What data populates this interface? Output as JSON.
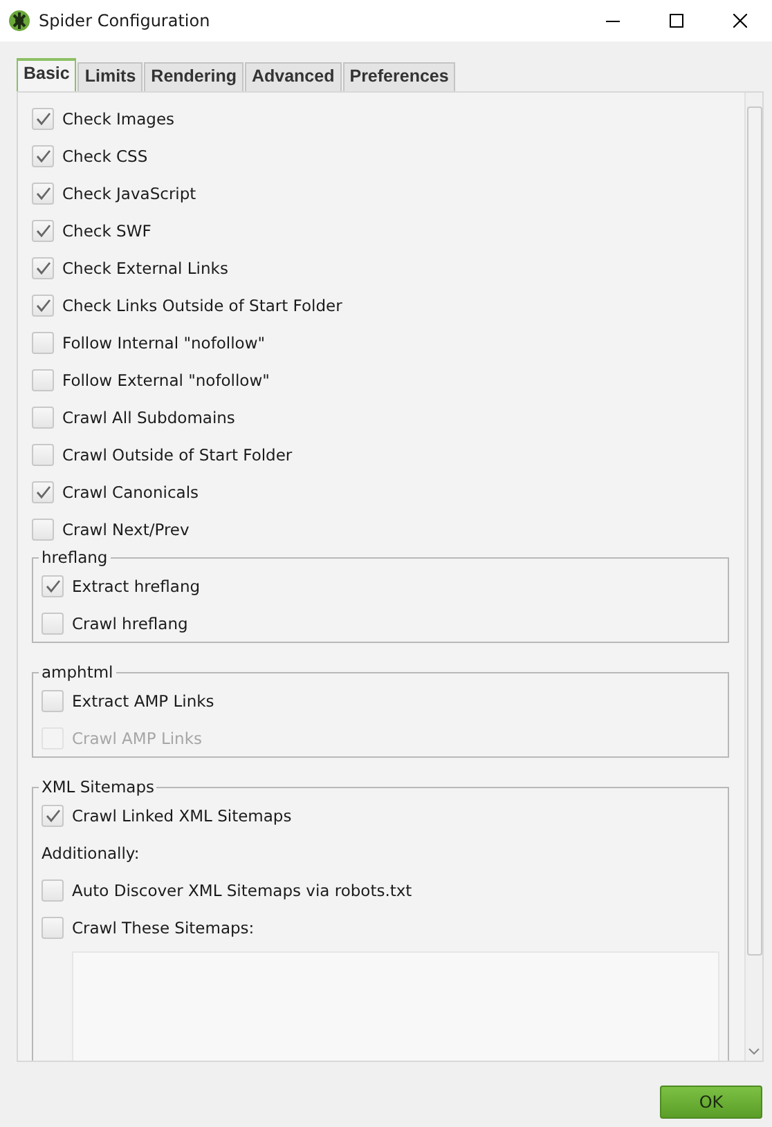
{
  "window": {
    "title": "Spider Configuration"
  },
  "tabs": [
    {
      "label": "Basic",
      "selected": true
    },
    {
      "label": "Limits",
      "selected": false
    },
    {
      "label": "Rendering",
      "selected": false
    },
    {
      "label": "Advanced",
      "selected": false
    },
    {
      "label": "Preferences",
      "selected": false
    }
  ],
  "options": [
    {
      "label": "Check Images",
      "checked": true
    },
    {
      "label": "Check CSS",
      "checked": true
    },
    {
      "label": "Check JavaScript",
      "checked": true
    },
    {
      "label": "Check SWF",
      "checked": true
    },
    {
      "label": "Check External Links",
      "checked": true
    },
    {
      "label": "Check Links Outside of Start Folder",
      "checked": true
    },
    {
      "label": "Follow Internal \"nofollow\"",
      "checked": false
    },
    {
      "label": "Follow External \"nofollow\"",
      "checked": false
    },
    {
      "label": "Crawl All Subdomains",
      "checked": false
    },
    {
      "label": "Crawl Outside of Start Folder",
      "checked": false
    },
    {
      "label": "Crawl Canonicals",
      "checked": true
    },
    {
      "label": "Crawl Next/Prev",
      "checked": false
    }
  ],
  "groups": [
    {
      "title": "hreflang",
      "items": [
        {
          "kind": "checkbox",
          "label": "Extract hreflang",
          "checked": true,
          "disabled": false
        },
        {
          "kind": "checkbox",
          "label": "Crawl hreflang",
          "checked": false,
          "disabled": false
        }
      ]
    },
    {
      "title": "amphtml",
      "items": [
        {
          "kind": "checkbox",
          "label": "Extract AMP Links",
          "checked": false,
          "disabled": false
        },
        {
          "kind": "checkbox",
          "label": "Crawl AMP Links",
          "checked": false,
          "disabled": true
        }
      ]
    },
    {
      "title": "XML Sitemaps",
      "items": [
        {
          "kind": "checkbox",
          "label": "Crawl Linked XML Sitemaps",
          "checked": true,
          "disabled": false
        },
        {
          "kind": "text",
          "label": "Additionally:"
        },
        {
          "kind": "checkbox",
          "label": "Auto Discover XML Sitemaps via robots.txt",
          "checked": false,
          "disabled": false
        },
        {
          "kind": "checkbox",
          "label": "Crawl These Sitemaps:",
          "checked": false,
          "disabled": false
        },
        {
          "kind": "list_box"
        }
      ]
    }
  ],
  "ok_button": "OK"
}
